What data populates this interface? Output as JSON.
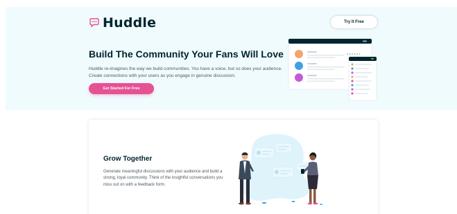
{
  "header": {
    "logo_text": "Huddle",
    "try_label": "Try It Free"
  },
  "hero": {
    "title": "Build The Community Your Fans Will Love",
    "description": "Huddle re-imagines the way we build communities. You have a voice, but so does your audience. Create connections with your users as you engage in genuine discussion.",
    "cta_label": "Get Started For Free"
  },
  "features": [
    {
      "title": "Grow Together",
      "description": "Generate meaningful discussions with your audience and build a strong, loyal community. Think of the insightful conversations you miss out on with a feedback form."
    }
  ],
  "colors": {
    "brand_pink": "#e55293",
    "dark_cyan": "#00252e",
    "hero_bg": "#f0fbfe",
    "body_text": "#4d5a62"
  },
  "icons": [
    "chat-bubble-logo-icon"
  ]
}
